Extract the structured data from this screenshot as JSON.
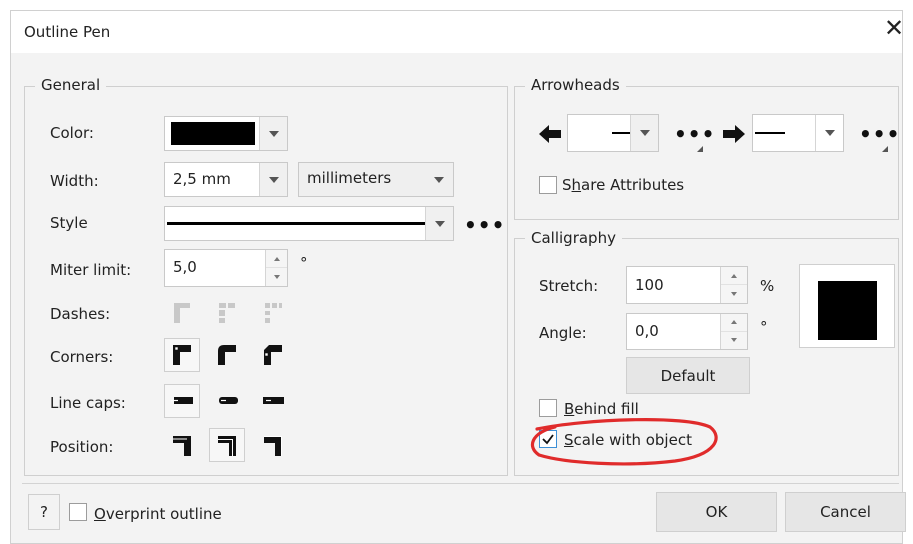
{
  "window": {
    "title": "Outline Pen",
    "close_symbol": "✕"
  },
  "general": {
    "legend": "General",
    "color_label": "Color:",
    "color_value": "#000000",
    "width_label": "Width:",
    "width_value": "2,5 mm",
    "width_units": "millimeters",
    "style_label": "Style",
    "miter_label": "Miter limit:",
    "miter_value": "5,0",
    "miter_unit": "°",
    "dashes_label": "Dashes:",
    "corners_label": "Corners:",
    "linecaps_label": "Line caps:",
    "position_label": "Position:"
  },
  "arrowheads": {
    "legend": "Arrowheads",
    "share_label": "Share Attributes",
    "share_access_key": "h"
  },
  "calligraphy": {
    "legend": "Calligraphy",
    "stretch_label": "Stretch:",
    "stretch_value": "100",
    "stretch_unit": "%",
    "angle_label": "Angle:",
    "angle_value": "0,0",
    "angle_unit": "°",
    "default_button": "Default",
    "behind_fill_label": "Behind fill",
    "scale_with_object_label": "Scale with object",
    "scale_with_object_checked": true,
    "behind_fill_checked": false
  },
  "footer": {
    "help_button": "?",
    "overprint_label": "Overprint outline",
    "ok_button": "OK",
    "cancel_button": "Cancel"
  },
  "annotation_color": "#e02b2b"
}
